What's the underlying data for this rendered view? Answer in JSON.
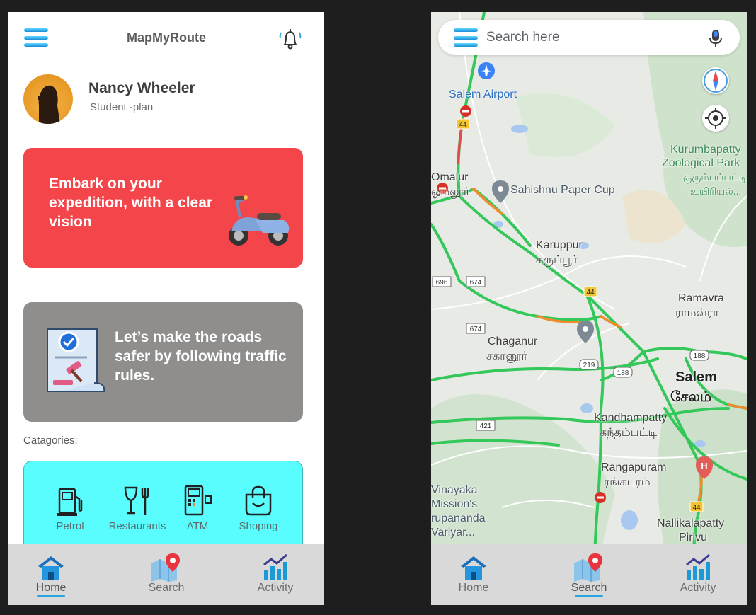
{
  "home": {
    "app_title": "MapMyRoute",
    "user": {
      "name": "Nancy Wheeler",
      "plan": "Student -plan"
    },
    "card1_text": "Embark on your expedition, with a clear vision",
    "card2_text": "Let’s make the roads safer by following traffic rules.",
    "categories_heading": "Catagories:",
    "categories": [
      {
        "label": "Petrol",
        "icon": "fuel-pump-icon"
      },
      {
        "label": "Restaurants",
        "icon": "fork-glass-icon"
      },
      {
        "label": "ATM",
        "icon": "atm-machine-icon"
      },
      {
        "label": "Shoping",
        "icon": "shopping-bag-icon"
      }
    ],
    "colors": {
      "card_red": "#f4464a",
      "card_grey": "#8f8e8d",
      "category_bg": "#59fdfd",
      "accent": "#2aa3e0"
    }
  },
  "nav": {
    "home": "Home",
    "search": "Search",
    "activity": "Activity"
  },
  "map": {
    "search_placeholder": "Search here",
    "labels": {
      "salem_airport": "Salem Airport",
      "omalur": "Omalur",
      "omalur_ta": "ஓமலூர்",
      "sahishnu": "Sahishnu Paper Cup",
      "kurumbapatty_1": "Kurumbapatty",
      "kurumbapatty_2": "Zoological Park",
      "kurumbapatty_ta1": "குரும்பப்பட்டி",
      "kurumbapatty_ta2": "உயிரியல்...",
      "karuppur": "Karuppur",
      "karuppur_ta": "கருப்பூர்",
      "ramavra": "Ramavra",
      "ramavra_ta": "ராமவ்ரா",
      "chaganur": "Chaganur",
      "chaganur_ta": "சகானூர்",
      "salem": "Salem",
      "salem_ta": "சேலம்",
      "kandhampatty": "Kandhampatty",
      "kandhampatty_ta": "கந்தம்பட்டி",
      "rangapuram": "Rangapuram",
      "rangapuram_ta": "ரங்கபுரம்",
      "vinayaka_1": "Vinayaka",
      "vinayaka_2": "Mission's",
      "vinayaka_3": "rupananda",
      "vinayaka_4": "Variyar...",
      "nallikalapatty": "Nallikalapatty",
      "nallikalapatty_2": "Pirivu"
    },
    "road_shields": [
      "44",
      "44",
      "44",
      "696",
      "674",
      "674",
      "219",
      "188",
      "188",
      "421"
    ]
  }
}
